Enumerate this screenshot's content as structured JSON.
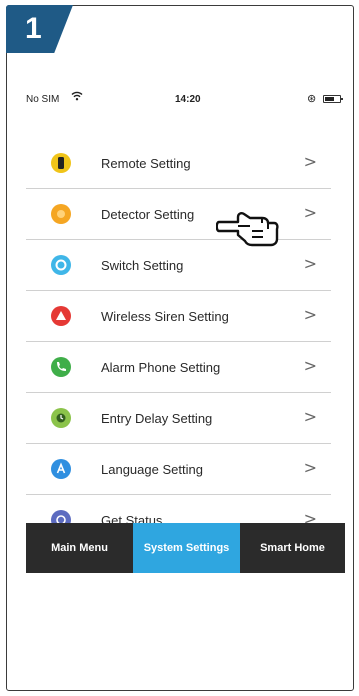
{
  "step_number": "1",
  "status_bar": {
    "carrier": "No SIM",
    "time": "14:20"
  },
  "menu": {
    "items": [
      {
        "label": "Remote Setting",
        "icon": "remote-icon",
        "color": "#f0c419"
      },
      {
        "label": "Detector Setting",
        "icon": "detector-icon",
        "color": "#f5a623"
      },
      {
        "label": "Switch Setting",
        "icon": "switch-icon",
        "color": "#3fb6e8"
      },
      {
        "label": "Wireless Siren Setting",
        "icon": "siren-icon",
        "color": "#e53935"
      },
      {
        "label": "Alarm Phone Setting",
        "icon": "phone-icon",
        "color": "#3fae49"
      },
      {
        "label": "Entry Delay Setting",
        "icon": "delay-icon",
        "color": "#8bc34a"
      },
      {
        "label": "Language Setting",
        "icon": "language-icon",
        "color": "#2f8fe0"
      },
      {
        "label": "Get Status",
        "icon": "status-icon",
        "color": "#5c6bc0"
      }
    ],
    "chevron": ">"
  },
  "tabs": [
    {
      "label": "Main Menu"
    },
    {
      "label": "System Settings"
    },
    {
      "label": "Smart Home"
    }
  ],
  "colors": {
    "badge": "#1f5a86",
    "tab_bar": "#2b2b2b",
    "tab_active": "#2fa6e0"
  }
}
